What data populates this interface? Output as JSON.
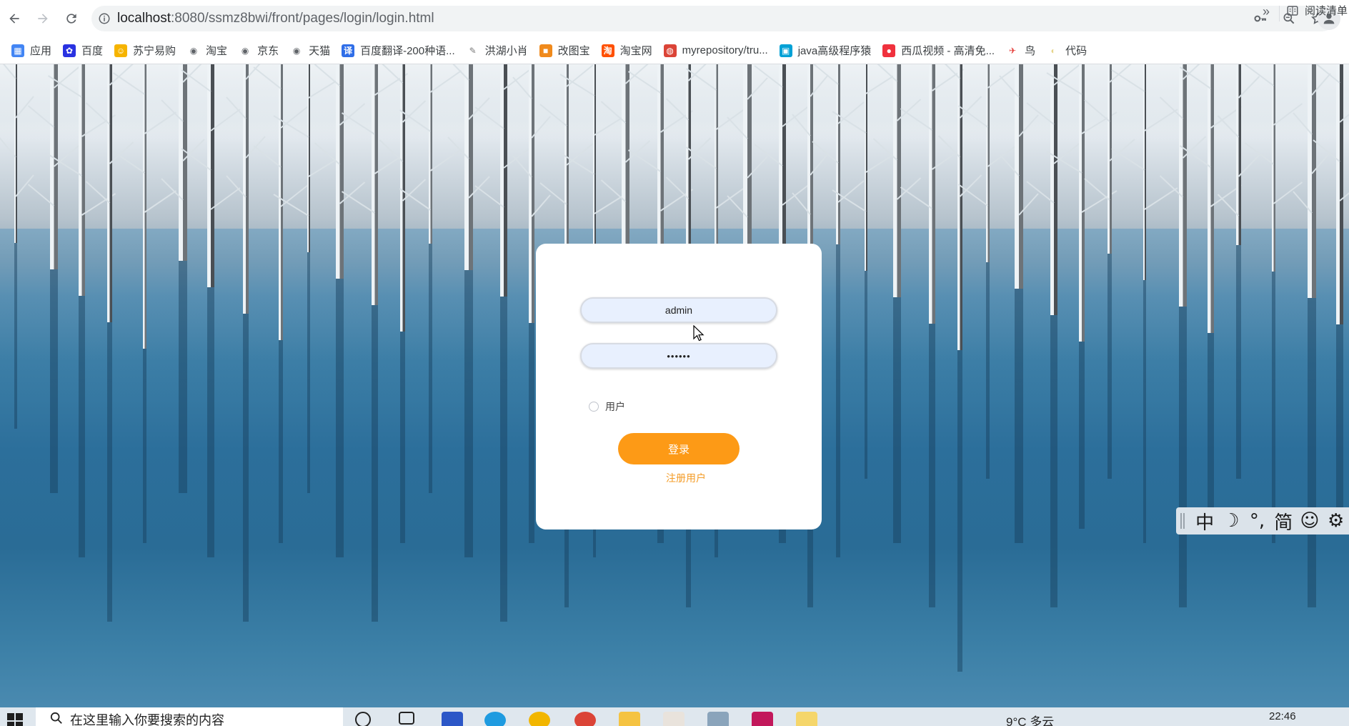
{
  "browser": {
    "url_host": "localhost",
    "url_rest": ":8080/ssmz8bwi/front/pages/login/login.html",
    "bookmarks": [
      {
        "label": "应用",
        "icon": "apps-grid-icon",
        "color": "#4285f4"
      },
      {
        "label": "百度",
        "icon": "baidu-paw-icon",
        "color": "#2932e1"
      },
      {
        "label": "苏宁易购",
        "icon": "suning-icon",
        "color": "#f6b400"
      },
      {
        "label": "淘宝",
        "icon": "globe-icon",
        "color": "#5f6368"
      },
      {
        "label": "京东",
        "icon": "globe-icon",
        "color": "#5f6368"
      },
      {
        "label": "天猫",
        "icon": "globe-icon",
        "color": "#5f6368"
      },
      {
        "label": "百度翻译-200种语...",
        "icon": "baidu-translate-icon",
        "color": "#2f6ee8"
      },
      {
        "label": "洪湖小肖",
        "icon": "feather-icon",
        "color": "#7a7a7a"
      },
      {
        "label": "改图宝",
        "icon": "gaitubao-icon",
        "color": "#f08a1c"
      },
      {
        "label": "淘宝网",
        "icon": "taobao-icon",
        "color": "#ff5000"
      },
      {
        "label": "myrepository/tru...",
        "icon": "chrome-icon",
        "color": "#db4437"
      },
      {
        "label": "java高级程序猿",
        "icon": "bilibili-icon",
        "color": "#00a1d6"
      },
      {
        "label": "西瓜视频 - 高清免...",
        "icon": "xigua-icon",
        "color": "#f0313d"
      },
      {
        "label": "鸟",
        "icon": "bird-icon",
        "color": "#e53935"
      },
      {
        "label": "代码",
        "icon": "code-icon",
        "color": "#e6d48a"
      }
    ],
    "more_label": "»",
    "reading_list_label": "阅读清单"
  },
  "login": {
    "username_value": "admin",
    "password_value": "••••••",
    "role_label": "用户",
    "login_button": "登录",
    "register_link": "注册用户"
  },
  "ime": {
    "items": [
      "中",
      "☽",
      "°,",
      "简",
      "☺",
      "⚙"
    ]
  },
  "taskbar": {
    "search_placeholder": "在这里输入你要搜索的内容",
    "weather": "9°C 多云",
    "clock": "22:46"
  },
  "colors": {
    "accent_orange": "#fd9a16",
    "link_orange": "#f49c27",
    "input_fill": "#e8f0fe"
  }
}
